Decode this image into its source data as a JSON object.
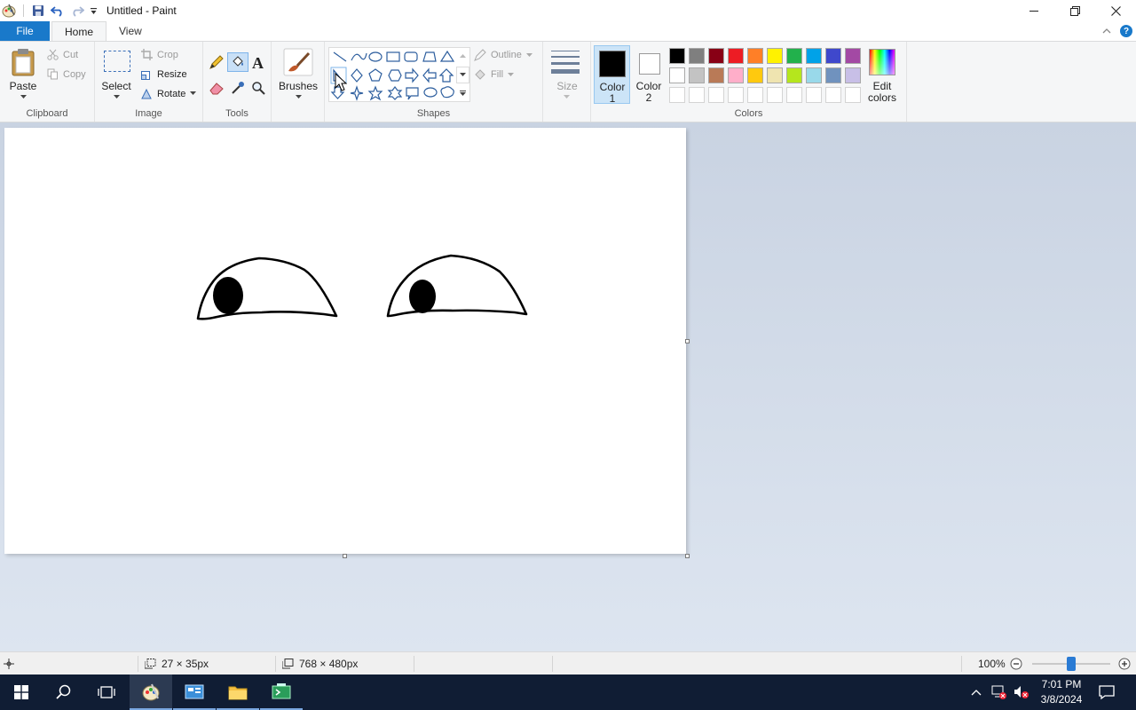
{
  "window": {
    "title": "Untitled - Paint"
  },
  "tabs": {
    "file": "File",
    "home": "Home",
    "view": "View"
  },
  "clipboard": {
    "paste": "Paste",
    "cut": "Cut",
    "copy": "Copy",
    "label": "Clipboard"
  },
  "image": {
    "select": "Select",
    "crop": "Crop",
    "resize": "Resize",
    "rotate": "Rotate",
    "label": "Image"
  },
  "tools": {
    "label": "Tools"
  },
  "brushes": {
    "label": "Brushes"
  },
  "shapes": {
    "outline": "Outline",
    "fill": "Fill",
    "label": "Shapes"
  },
  "size": {
    "label": "Size"
  },
  "colors": {
    "color1_line1": "Color",
    "color1_line2": "1",
    "color2_line1": "Color",
    "color2_line2": "2",
    "edit_line1": "Edit",
    "edit_line2": "colors",
    "label": "Colors",
    "color1_value": "#000000",
    "color2_value": "#ffffff",
    "palette_row1": [
      "#000000",
      "#7f7f7f",
      "#880015",
      "#ed1c24",
      "#ff7f27",
      "#fff200",
      "#22b14c",
      "#00a2e8",
      "#3f48cc",
      "#a349a4"
    ],
    "palette_row2": [
      "#ffffff",
      "#c3c3c3",
      "#b97a57",
      "#ffaec9",
      "#ffc90e",
      "#efe4b0",
      "#b5e61d",
      "#99d9ea",
      "#7092be",
      "#c8bfe7"
    ]
  },
  "status": {
    "selection_size": "27 × 35px",
    "canvas_size": "768 × 480px",
    "zoom": "100%"
  },
  "clock": {
    "time": "7:01 PM",
    "date": "3/8/2024"
  }
}
